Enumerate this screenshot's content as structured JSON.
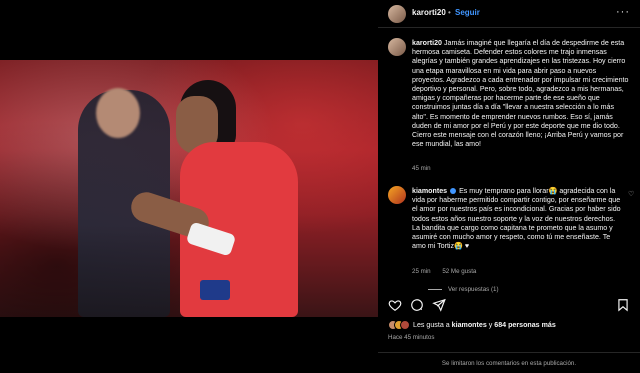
{
  "header": {
    "username": "karorti20",
    "dot": "•",
    "follow_label": "Seguir",
    "more": "···"
  },
  "caption": {
    "username": "karorti20",
    "text": "Jamás imaginé que llegaría el día de despedirme de esta hermosa camiseta. Defender estos colores me trajo inmensas alegrías y también grandes aprendizajes en las tristezas. Hoy cierro una etapa maravillosa en mi vida para abrir paso a nuevos proyectos. Agradezco a cada entrenador por impulsar mi crecimiento deportivo y personal. Pero, sobre todo, agradezco a mis hermanas, amigas y compañeras por hacerme parte de ese sueño que construimos juntas día a día \"llevar a nuestra selección a lo más alto\". Es momento de emprender nuevos rumbos. Eso sí, jamás duden de mi amor por el Perú y por este deporte que me dio todo. Cierro este mensaje con el corazón lleno; ¡Arriba Perú y vamos por ese mundial, las amo!",
    "time": "45 min"
  },
  "comment": {
    "username": "kiamontes",
    "text": "Es muy temprano para llorar😭 agradecida con la vida por haberme permitido compartir contigo, por enseñarme que el amor por nuestros país es incondicional. Gracias por haber sido todos estos años nuestro soporte y la voz de nuestros derechos. La bandita que cargo como capitana te prometo que la asumo y asumiré con mucho amor y respeto, como tú me enseñaste. Te amo mi Tortiz😭 ♥",
    "time": "25 min",
    "likes": "52 Me gusta",
    "replies": "Ver respuestas (1)"
  },
  "likes": {
    "prefix": "Les gusta a",
    "user": "kiamontes",
    "connector": "y",
    "count": "684 personas más"
  },
  "post_time": "Hace 45 minutos",
  "footer": "Se limitaron los comentarios en esta publicación.",
  "icons": {
    "like": "heart-icon",
    "comment": "comment-icon",
    "share": "share-icon",
    "save": "bookmark-icon"
  },
  "colors": {
    "background": "#000000",
    "link_blue": "#4096ff",
    "secondary_text": "#a8a8a8",
    "jersey_red": "#e23a3f"
  }
}
